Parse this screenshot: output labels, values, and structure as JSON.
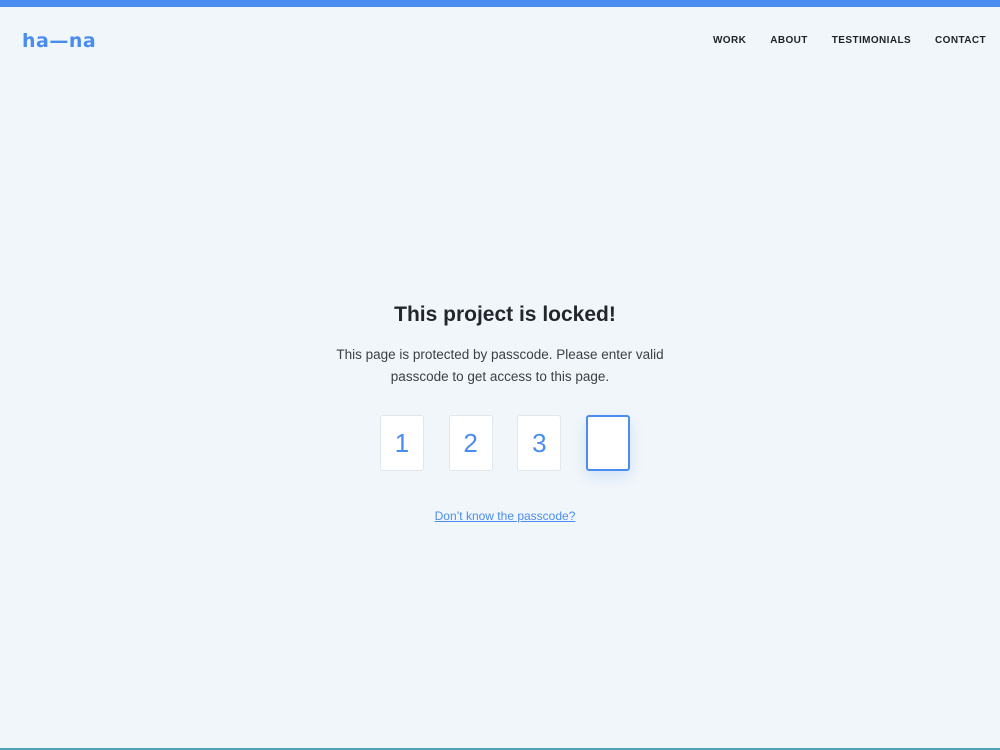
{
  "brand": {
    "logo_text": "ha—na",
    "accent_color": "#4a8df0"
  },
  "nav": {
    "items": [
      {
        "label": "WORK"
      },
      {
        "label": "ABOUT"
      },
      {
        "label": "TESTIMONIALS"
      },
      {
        "label": "CONTACT"
      }
    ]
  },
  "lock": {
    "title": "This project is locked!",
    "description": "This page is protected by passcode. Please enter valid passcode to get access to this page.",
    "code_digits": [
      "1",
      "2",
      "3",
      ""
    ],
    "active_digit_index": 3,
    "help_link": "Don’t know the passcode?"
  }
}
